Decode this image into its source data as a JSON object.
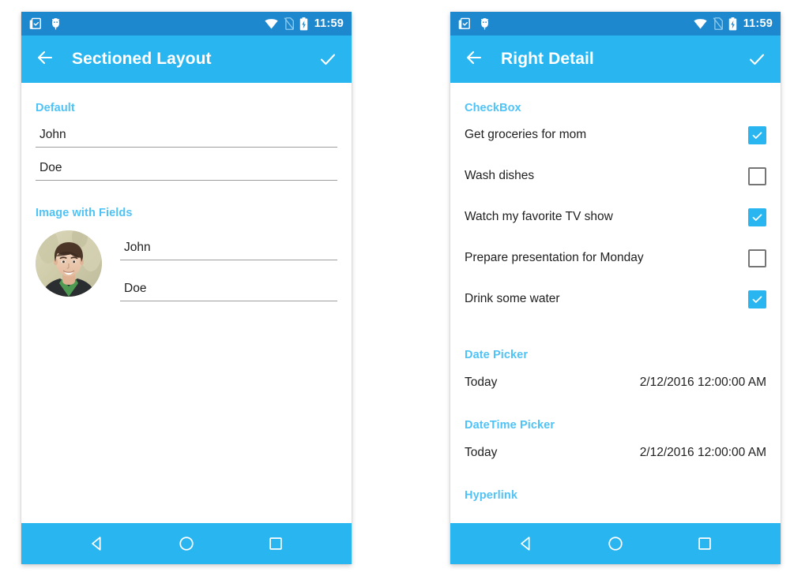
{
  "page": {
    "background": "#ffffff",
    "accent_blue": "#29B6F0",
    "status_blue": "#1E88CF",
    "section_header_blue": "#4FC3F7",
    "text_color": "#212121",
    "underline_color": "#9E9E9E"
  },
  "status_bar": {
    "time": "11:59",
    "left_icons": [
      "clipboard-check-icon",
      "android-debug-icon"
    ],
    "right_icons": [
      "wifi-icon",
      "no-sim-icon",
      "battery-charging-icon"
    ]
  },
  "nav_bar": {
    "back_label": "Back",
    "home_label": "Home",
    "recents_label": "Recents"
  },
  "left_phone": {
    "app_bar": {
      "back_icon": "arrow-back-icon",
      "title": "Sectioned Layout",
      "action_icon": "check-icon"
    },
    "sections": [
      {
        "header": "Default",
        "fields": [
          {
            "value": "John"
          },
          {
            "value": "Doe"
          }
        ]
      },
      {
        "header": "Image with Fields",
        "avatar_alt": "user-portrait",
        "fields": [
          {
            "value": "John"
          },
          {
            "value": "Doe"
          }
        ]
      }
    ]
  },
  "right_phone": {
    "app_bar": {
      "back_icon": "arrow-back-icon",
      "title": "Right Detail",
      "action_icon": "check-icon"
    },
    "checkbox_section": {
      "header": "CheckBox",
      "items": [
        {
          "label": "Get groceries for mom",
          "checked": true
        },
        {
          "label": "Wash dishes",
          "checked": false
        },
        {
          "label": "Watch my favorite TV show",
          "checked": true
        },
        {
          "label": "Prepare presentation for Monday",
          "checked": false
        },
        {
          "label": "Drink some water",
          "checked": true
        }
      ]
    },
    "date_picker_section": {
      "header": "Date Picker",
      "row_label": "Today",
      "row_value": "2/12/2016 12:00:00 AM"
    },
    "datetime_picker_section": {
      "header": "DateTime Picker",
      "row_label": "Today",
      "row_value": "2/12/2016 12:00:00 AM"
    },
    "hyperlink_section": {
      "header": "Hyperlink"
    }
  }
}
